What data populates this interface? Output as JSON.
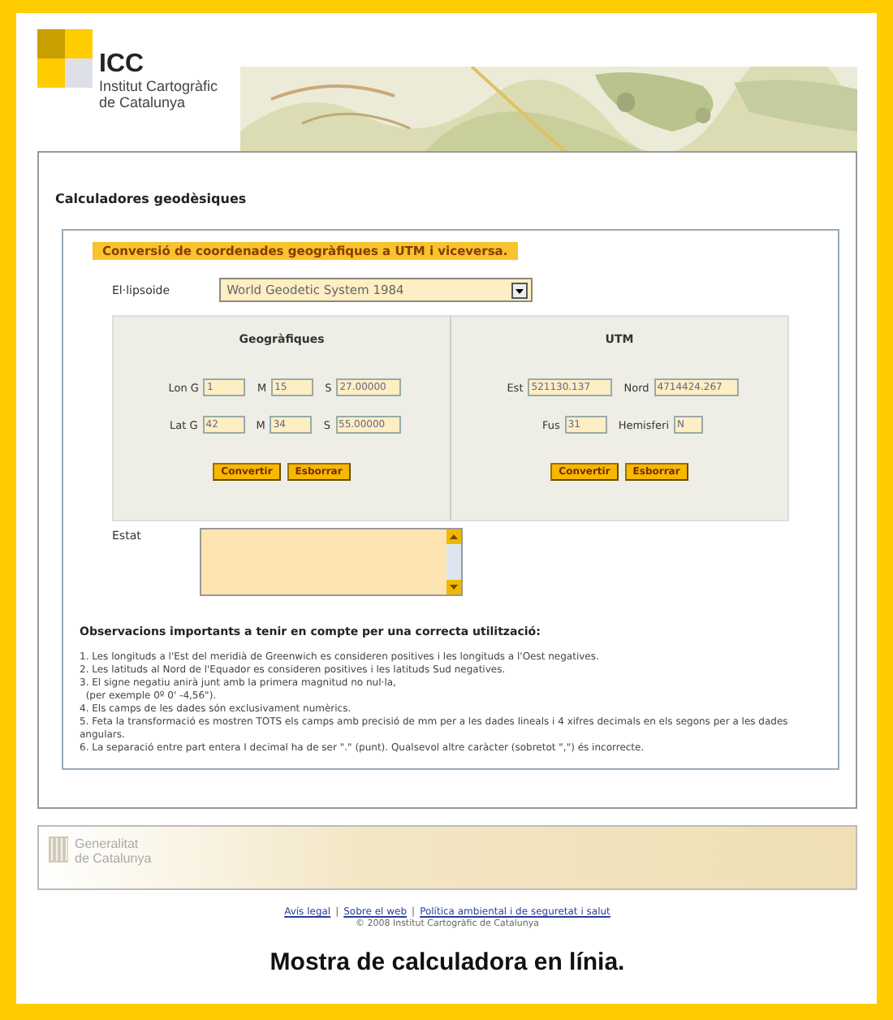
{
  "header": {
    "logo_abbr": "ICC",
    "logo_lines": [
      "Institut Cartogràfic",
      "de Catalunya"
    ]
  },
  "page_title": "Calculadores geodèsiques",
  "converter": {
    "legend": "Conversió de coordenades geogràfiques a UTM i viceversa.",
    "ellipsoid": {
      "label": "El·lipsoide",
      "value": "World Geodetic System 1984"
    },
    "geographic": {
      "title": "Geogràfiques",
      "rows": [
        {
          "fields": [
            {
              "label": "Lon G",
              "value": "1"
            },
            {
              "label": "M",
              "value": "15"
            },
            {
              "label": "S",
              "value": "27.00000"
            }
          ]
        },
        {
          "fields": [
            {
              "label": "Lat G",
              "value": "42"
            },
            {
              "label": "M",
              "value": "34"
            },
            {
              "label": "S",
              "value": "55.00000"
            }
          ]
        }
      ],
      "buttons": [
        "Convertir",
        "Esborrar"
      ]
    },
    "utm": {
      "title": "UTM",
      "rows": [
        {
          "fields": [
            {
              "label": "Est",
              "value": "521130.137"
            },
            {
              "label": "Nord",
              "value": "4714424.267"
            }
          ]
        },
        {
          "fields": [
            {
              "label": "Fus",
              "value": "31"
            },
            {
              "label": "Hemisferi",
              "value": "N"
            }
          ]
        }
      ],
      "buttons": [
        "Convertir",
        "Esborrar"
      ]
    },
    "status_label": "Estat"
  },
  "notes": {
    "title": "Observacions importants a tenir en compte per una correcta utilització:",
    "items": [
      "1. Les longituds a l'Est del meridià de Greenwich es consideren positives i les longituds a l'Oest negatives.",
      "2. Les latituds al Nord de l'Equador es consideren positives i les latituds Sud negatives.",
      "3. El signe negatiu anirà junt amb la primera magnitud no nul·la,\n  (per exemple 0º 0' -4,56\").",
      "4. Els camps de les dades són exclusivament numèrics.",
      "5. Feta la transformació es mostren TOTS els camps amb precisió de mm per a les dades lineals i 4 xifres decimals en els segons per a les dades angulars.",
      "6. La separació entre part entera I decimal ha de ser \".\" (punt). Qualsevol altre caràcter (sobretot \",\") és incorrecte."
    ]
  },
  "footer": {
    "brand_lines": [
      "Generalitat",
      "de Catalunya"
    ],
    "links": [
      "Avís legal",
      "Sobre el web",
      "Política ambiental i de seguretat i salut"
    ],
    "separator": "|",
    "copyright": "© 2008 Institut Cartogràfic de Catalunya"
  },
  "caption": "Mostra de calculadora en línia."
}
